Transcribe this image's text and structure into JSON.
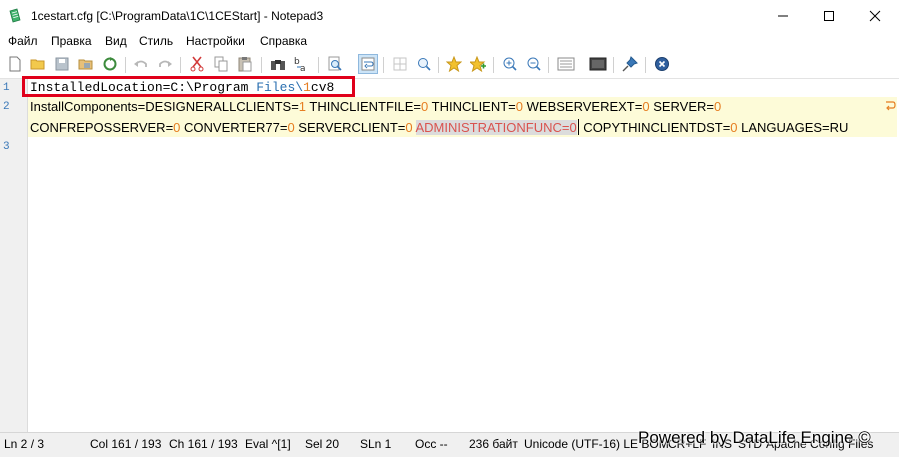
{
  "window": {
    "title": "1cestart.cfg [C:\\ProgramData\\1C\\1CEStart] - Notepad3"
  },
  "menu": [
    "Файл",
    "Правка",
    "Вид",
    "Стиль",
    "Настройки",
    "Справка"
  ],
  "editor": {
    "line_numbers": [
      "1",
      "2",
      "3"
    ],
    "line1": {
      "a": "InstalledLocation=C:\\Program ",
      "b": "Files",
      "c": "\\",
      "d": "1",
      "e": "cv8"
    },
    "line2a": [
      {
        "k": "InstallComponents=DESIGNERALLCLIENTS=",
        "v": "1"
      },
      {
        "k": " THINCLIENTFILE=",
        "v": "0"
      },
      {
        "k": " THINCLIENT=",
        "v": "0"
      },
      {
        "k": " WEBSERVEREXT=",
        "v": "0"
      },
      {
        "k": " SERVER=",
        "v": "0"
      }
    ],
    "line2b": {
      "p1k": "CONFREPOSSERVER=",
      "p1v": "0",
      "p2k": " CONVERTER77=",
      "p2v": "0",
      "p3k": " SERVERCLIENT=",
      "p3v": "0",
      "selected": "ADMINISTRATIONFUNC=0",
      "p4k": " COPYTHINCLIENTDST=",
      "p4v": "0",
      "p5k": " LANGUAGES=RU"
    }
  },
  "status": {
    "ln": "Ln  2 / 3",
    "col": "Col  161 / 193",
    "ch": "Ch  161 / 193",
    "eval": "Eval  ^[1]",
    "sel": "Sel  20",
    "sln": "SLn  1",
    "occ": "Occ  --",
    "size": "236 байт",
    "encoding": "Unicode (UTF-16) LE BOM",
    "eol": "CR+LF",
    "ins": "INS",
    "std": "STD",
    "lexer": "Apache Config Files"
  },
  "watermark": "Powered by DataLife Engine ©",
  "colors": {
    "value": "#e67e22",
    "highlight_box": "#e0001a",
    "current_line": "#fdfbd8"
  }
}
